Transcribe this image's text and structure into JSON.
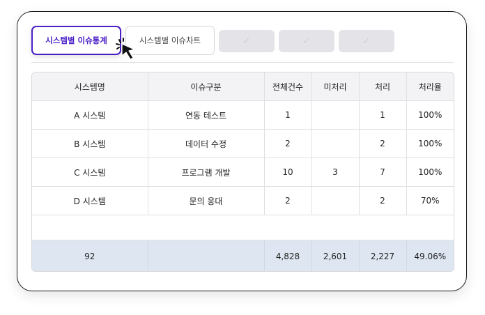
{
  "tabs": [
    {
      "label": "시스템별 이슈통계",
      "active": true
    },
    {
      "label": "시스템별 이슈차트",
      "active": false
    },
    {
      "label": "✓",
      "active": false
    },
    {
      "label": "✓",
      "active": false
    },
    {
      "label": "✓",
      "active": false
    }
  ],
  "table": {
    "headers": [
      "시스템명",
      "이슈구분",
      "전체건수",
      "미처리",
      "처리",
      "처리율"
    ],
    "rows": [
      [
        "A 시스템",
        "연동 테스트",
        "1",
        "",
        "1",
        "100%"
      ],
      [
        "B 시스템",
        "데이터 수정",
        "2",
        "",
        "2",
        "100%"
      ],
      [
        "C 시스템",
        "프로그램 개발",
        "10",
        "3",
        "7",
        "100%"
      ],
      [
        "D 시스템",
        "문의 응대",
        "2",
        "",
        "2",
        "70%"
      ]
    ],
    "total": [
      "92",
      "",
      "4,828",
      "2,601",
      "2,227",
      "49.06%"
    ]
  },
  "colors": {
    "accent": "#4b1fc7",
    "total_row_bg": "#dde6f1",
    "header_bg": "#f3f3f5"
  },
  "icons": {
    "cursor": "pointer-click-icon",
    "check": "check-icon"
  }
}
